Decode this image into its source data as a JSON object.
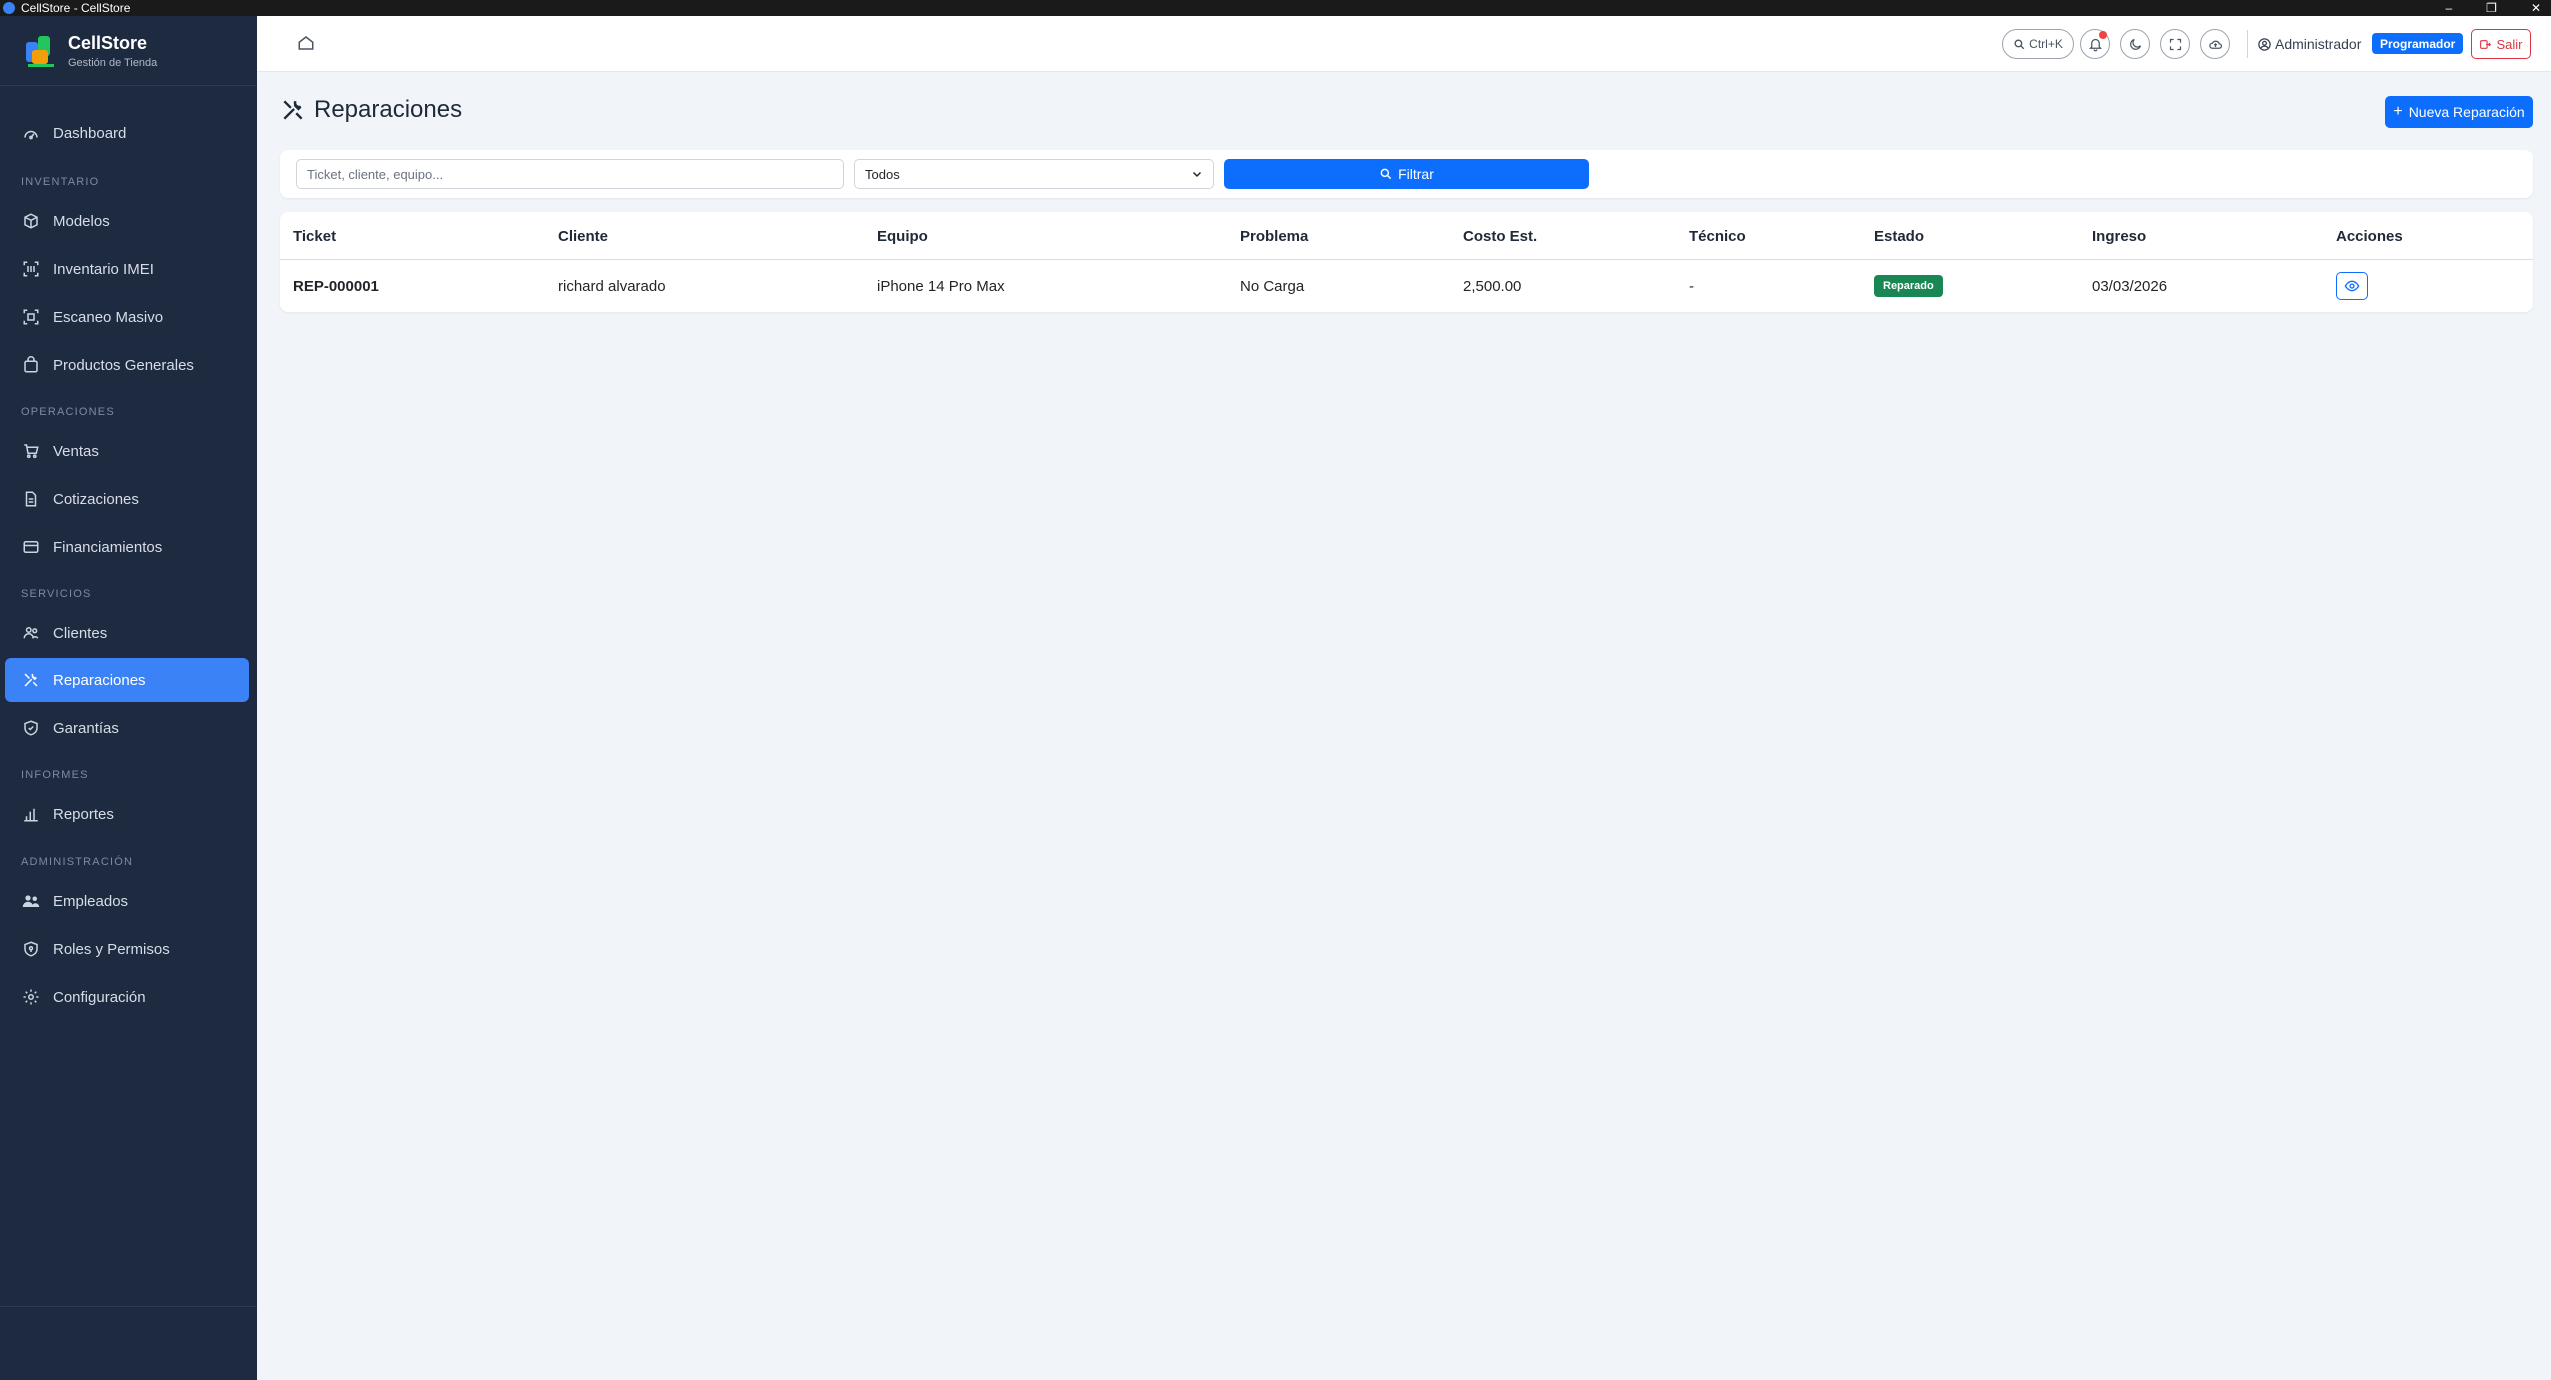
{
  "window": {
    "title": "CellStore - CellStore"
  },
  "brand": {
    "name": "CellStore",
    "subtitle": "Gestión de Tienda"
  },
  "sidebar": {
    "sections": {
      "inventario": "INVENTARIO",
      "operaciones": "OPERACIONES",
      "servicios": "SERVICIOS",
      "informes": "INFORMES",
      "administracion": "ADMINISTRACIÓN"
    },
    "items": {
      "dashboard": "Dashboard",
      "modelos": "Modelos",
      "inventario_imei": "Inventario IMEI",
      "escaneo_masivo": "Escaneo Masivo",
      "productos_generales": "Productos Generales",
      "ventas": "Ventas",
      "cotizaciones": "Cotizaciones",
      "financiamientos": "Financiamientos",
      "clientes": "Clientes",
      "reparaciones": "Reparaciones",
      "garantias": "Garantías",
      "reportes": "Reportes",
      "empleados": "Empleados",
      "roles_permisos": "Roles y Permisos",
      "configuracion": "Configuración"
    },
    "active": "reparaciones"
  },
  "topbar": {
    "shortcut_label": "Ctrl+K",
    "user_name": "Administrador",
    "role_badge": "Programador",
    "logout_label": "Salir"
  },
  "page": {
    "title": "Reparaciones",
    "new_button": "Nueva Reparación"
  },
  "filters": {
    "search_placeholder": "Ticket, cliente, equipo...",
    "status_selected": "Todos",
    "filter_button": "Filtrar"
  },
  "table": {
    "headers": [
      "Ticket",
      "Cliente",
      "Equipo",
      "Problema",
      "Costo Est.",
      "Técnico",
      "Estado",
      "Ingreso",
      "Acciones"
    ],
    "rows": [
      {
        "ticket": "REP-000001",
        "cliente": "richard alvarado",
        "equipo": "iPhone 14 Pro Max",
        "problema": "No Carga",
        "costo": "2,500.00",
        "tecnico": "-",
        "estado": "Reparado",
        "ingreso": "03/03/2026"
      }
    ]
  },
  "colors": {
    "sidebar_bg": "#1e2a3f",
    "active_item": "#3b82f6",
    "primary": "#0d6efd",
    "success": "#198754",
    "danger": "#dc3545"
  }
}
